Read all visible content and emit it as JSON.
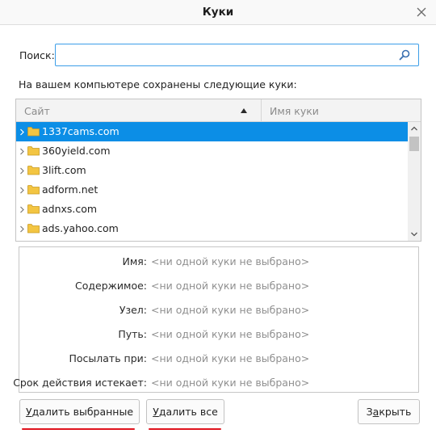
{
  "dialog": {
    "title": "Куки"
  },
  "search": {
    "label": "Поиск:",
    "value": "",
    "placeholder": ""
  },
  "intro": "На вашем компьютере сохранены следующие куки:",
  "columns": {
    "site": "Сайт",
    "cookie_name": "Имя куки"
  },
  "sites": [
    {
      "name": "1337cams.com",
      "selected": true
    },
    {
      "name": "360yield.com",
      "selected": false
    },
    {
      "name": "3lift.com",
      "selected": false
    },
    {
      "name": "adform.net",
      "selected": false
    },
    {
      "name": "adnxs.com",
      "selected": false
    },
    {
      "name": "ads.yahoo.com",
      "selected": false
    }
  ],
  "details": [
    {
      "label": "Имя:",
      "value": "<ни одной куки не выбрано>"
    },
    {
      "label": "Содержимое:",
      "value": "<ни одной куки не выбрано>"
    },
    {
      "label": "Узел:",
      "value": "<ни одной куки не выбрано>"
    },
    {
      "label": "Путь:",
      "value": "<ни одной куки не выбрано>"
    },
    {
      "label": "Посылать при:",
      "value": "<ни одной куки не выбрано>"
    },
    {
      "label": "Срок действия истекает:",
      "value": "<ни одной куки не выбрано>"
    }
  ],
  "buttons": {
    "remove_selected": {
      "mnemonic": "У",
      "rest": "далить выбранные"
    },
    "remove_all": {
      "mnemonic": "У",
      "rest": "далить все"
    },
    "close": {
      "lead": "З",
      "mnemonic": "а",
      "rest": "крыть"
    }
  },
  "colors": {
    "selection": "#0c8ee6",
    "annotation": "#e0141e",
    "focus_border": "#3c9ee8"
  },
  "icons": {
    "search": "search-icon",
    "close": "close-icon",
    "folder": "folder-icon",
    "twisty": "chevron-right-icon"
  }
}
